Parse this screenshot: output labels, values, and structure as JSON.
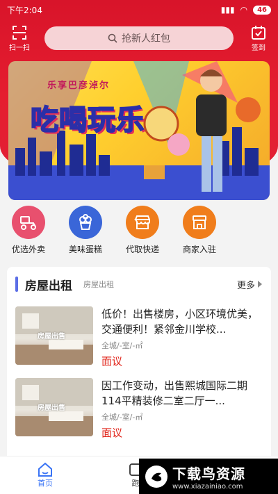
{
  "statusbar": {
    "time": "下午2:04",
    "battery": "46"
  },
  "topbar": {
    "scan_label": "扫一扫",
    "search_placeholder": "抢新人红包",
    "signin_label": "签到"
  },
  "banner": {
    "slogan": "乐享巴彦淖尔",
    "headline": "吃喝玩乐"
  },
  "quicknav": [
    {
      "label": "优选外卖",
      "icon": "delivery-scooter-icon",
      "color": "#e8506e"
    },
    {
      "label": "美味蛋糕",
      "icon": "cake-icon",
      "color": "#3a66d8"
    },
    {
      "label": "代取快递",
      "icon": "storefront-icon",
      "color": "#f07d1b"
    },
    {
      "label": "商家入驻",
      "icon": "shop-icon",
      "color": "#f07d1b"
    }
  ],
  "section": {
    "title": "房屋出租",
    "subtitle": "房屋出租",
    "more": "更多"
  },
  "listings": [
    {
      "thumb_label": "房屋出售",
      "title": "低价！出售楼房，小区环境优美，交通便利！紧邻金川学校...",
      "meta": "全城/-室/-㎡",
      "price": "面议"
    },
    {
      "thumb_label": "房屋出售",
      "title": "因工作变动，出售熙城国际二期114平精装修二室二厅一...",
      "meta": "全城/-室/-㎡",
      "price": "面议"
    }
  ],
  "tabbar": {
    "home": "首页",
    "run": "跑"
  },
  "watermark": {
    "title": "下载鸟资源",
    "url": "www.xiazainiao.com"
  }
}
